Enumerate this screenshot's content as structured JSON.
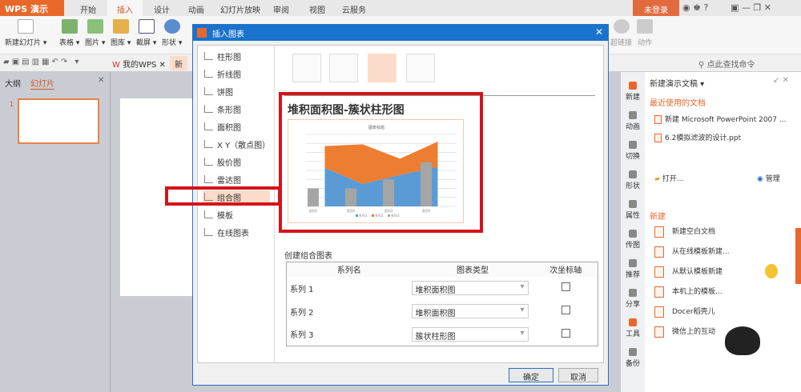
{
  "app": {
    "logo": "WPS 演示",
    "tabs": [
      "开始",
      "插入",
      "设计",
      "动画",
      "幻灯片放映",
      "审阅",
      "视图",
      "云服务"
    ],
    "active_tab": "插入",
    "login": "未登录"
  },
  "ribbon": {
    "buttons": [
      "新建幻灯片 ▾",
      "表格 ▾",
      "图片 ▾",
      "图库 ▾",
      "截屏 ▾",
      "形状 ▾",
      "超链接",
      "动作"
    ]
  },
  "qat": {
    "doc_tabs": [
      "我的WPS",
      "新"
    ],
    "search": "点此查找命令"
  },
  "left_panel": {
    "tabs": [
      "大纲",
      "幻灯片"
    ],
    "active": "幻灯片",
    "slide_number": "1"
  },
  "dialog": {
    "title": "插入图表",
    "categories": [
      "柱形图",
      "折线图",
      "饼图",
      "条形图",
      "面积图",
      "X Y（散点图）",
      "股价图",
      "雷达图",
      "组合图",
      "模板",
      "在线图表"
    ],
    "selected_category": "组合图",
    "preview_title": "堆积面积图-簇状柱形图",
    "section_label": "创建组合图表",
    "table_headers": [
      "系列名",
      "图表类型",
      "次坐标轴"
    ],
    "rows": [
      {
        "name": "系列 1",
        "type": "堆积面积图",
        "secondary": false
      },
      {
        "name": "系列 2",
        "type": "堆积面积图",
        "secondary": false
      },
      {
        "name": "系列 3",
        "type": "簇状柱形图",
        "secondary": false
      }
    ],
    "ok": "确定",
    "cancel": "取消"
  },
  "chart_data": {
    "type": "combo",
    "title": "图表标题",
    "categories": [
      "类别1",
      "类别2",
      "类别3",
      "类别4"
    ],
    "ylim": [
      0,
      8
    ],
    "series": [
      {
        "name": "系列1",
        "kind": "stacked-area",
        "values": [
          4.3,
          2.5,
          3.5,
          4.4
        ],
        "color": "#5b9bd5"
      },
      {
        "name": "系列2",
        "kind": "stacked-area",
        "values": [
          2.4,
          4.4,
          1.8,
          2.8
        ],
        "color": "#ed7d31"
      },
      {
        "name": "系列3",
        "kind": "bar",
        "values": [
          2.0,
          2.0,
          3.0,
          4.9
        ],
        "color": "#a5a5a5"
      }
    ]
  },
  "right_side": {
    "items": [
      "新建",
      "动画",
      "切换",
      "形状",
      "属性",
      "传图",
      "推荐",
      "分享",
      "工具",
      "备份"
    ]
  },
  "task_pane": {
    "title": "新建演示文稿 ▾",
    "recent_header": "最近使用的文档",
    "recent": [
      "新建 Microsoft PowerPoint 2007 ...",
      "6.2模拟滤波的设计.ppt"
    ],
    "open": "打开...",
    "manage": "管理",
    "new_header": "新建",
    "new_items": [
      "新建空白文档",
      "从在线模板新建...",
      "从默认模板新建",
      "本机上的模板...",
      "Docer稻壳儿",
      "微信上的互动"
    ]
  }
}
